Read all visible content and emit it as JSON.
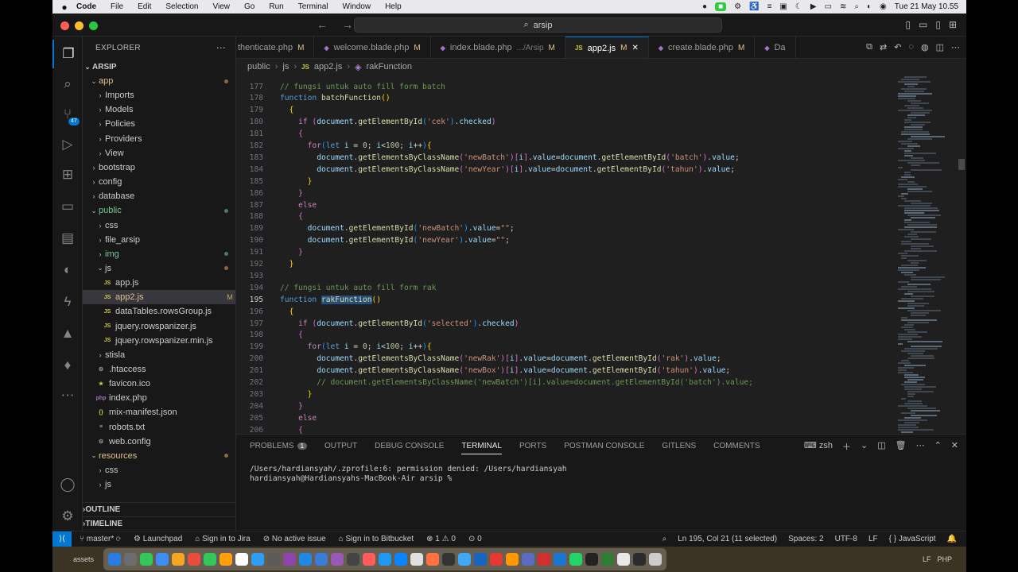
{
  "menubar": {
    "apple": "",
    "items": [
      "Code",
      "File",
      "Edit",
      "Selection",
      "View",
      "Go",
      "Run",
      "Terminal",
      "Window",
      "Help"
    ],
    "clock": "Tue 21 May  10.55"
  },
  "titlebar": {
    "search": "arsip"
  },
  "activity": {
    "source_control_badge": "47"
  },
  "explorer": {
    "title": "EXPLORER",
    "project": "ARSIP",
    "tree": [
      {
        "label": "app",
        "kind": "folder-open",
        "color": "mod",
        "indent": 1,
        "mark": "dot"
      },
      {
        "label": "Imports",
        "kind": "folder",
        "indent": 2
      },
      {
        "label": "Models",
        "kind": "folder",
        "indent": 2
      },
      {
        "label": "Policies",
        "kind": "folder",
        "indent": 2
      },
      {
        "label": "Providers",
        "kind": "folder",
        "indent": 2
      },
      {
        "label": "View",
        "kind": "folder",
        "indent": 2
      },
      {
        "label": "bootstrap",
        "kind": "folder",
        "indent": 1
      },
      {
        "label": "config",
        "kind": "folder",
        "indent": 1
      },
      {
        "label": "database",
        "kind": "folder",
        "indent": 1
      },
      {
        "label": "public",
        "kind": "folder-open",
        "color": "green",
        "indent": 1,
        "mark": "greendot"
      },
      {
        "label": "css",
        "kind": "folder",
        "indent": 2
      },
      {
        "label": "file_arsip",
        "kind": "folder",
        "indent": 2
      },
      {
        "label": "img",
        "kind": "folder",
        "color": "green",
        "indent": 2,
        "mark": "greendot"
      },
      {
        "label": "js",
        "kind": "folder-open",
        "indent": 2,
        "mark": "dot"
      },
      {
        "label": "app.js",
        "kind": "js",
        "indent": 3
      },
      {
        "label": "app2.js",
        "kind": "js",
        "color": "mod",
        "indent": 3,
        "mark": "M",
        "selected": true
      },
      {
        "label": "dataTables.rowsGroup.js",
        "kind": "js",
        "indent": 3
      },
      {
        "label": "jquery.rowspanizer.js",
        "kind": "js",
        "indent": 3
      },
      {
        "label": "jquery.rowspanizer.min.js",
        "kind": "js",
        "indent": 3
      },
      {
        "label": "stisla",
        "kind": "folder",
        "indent": 2
      },
      {
        "label": ".htaccess",
        "kind": "gear",
        "indent": 2
      },
      {
        "label": "favicon.ico",
        "kind": "star",
        "indent": 2
      },
      {
        "label": "index.php",
        "kind": "php",
        "indent": 2
      },
      {
        "label": "mix-manifest.json",
        "kind": "json",
        "indent": 2
      },
      {
        "label": "robots.txt",
        "kind": "txt",
        "indent": 2
      },
      {
        "label": "web.config",
        "kind": "gear",
        "indent": 2
      },
      {
        "label": "resources",
        "kind": "folder-open",
        "color": "mod",
        "indent": 1,
        "mark": "dot"
      },
      {
        "label": "css",
        "kind": "folder",
        "indent": 2
      },
      {
        "label": "js",
        "kind": "folder",
        "indent": 2
      }
    ],
    "outline": "OUTLINE",
    "timeline": "TIMELINE"
  },
  "tabs": [
    {
      "label": "thenticate.php",
      "icon": "php",
      "mark": "M"
    },
    {
      "label": "welcome.blade.php",
      "icon": "php",
      "mark": "M"
    },
    {
      "label": "index.blade.php",
      "icon": "php",
      "path": ".../Arsip",
      "mark": "M"
    },
    {
      "label": "app2.js",
      "icon": "js",
      "mark": "M",
      "active": true
    },
    {
      "label": "create.blade.php",
      "icon": "php",
      "mark": "M"
    },
    {
      "label": "Da",
      "icon": "php",
      "mark": ""
    }
  ],
  "breadcrumb": [
    "public",
    "js",
    "app2.js",
    "rakFunction"
  ],
  "code": [
    {
      "n": "177",
      "t": [
        [
          "cm",
          "// fungsi untuk auto fill form batch"
        ]
      ]
    },
    {
      "n": "178",
      "t": [
        [
          "kw",
          "function "
        ],
        [
          "fn",
          "batchFunction"
        ],
        [
          "br1",
          "()"
        ]
      ]
    },
    {
      "n": "179",
      "t": [
        [
          "plain",
          "  "
        ],
        [
          "br1",
          "{"
        ]
      ]
    },
    {
      "n": "180",
      "t": [
        [
          "plain",
          "    "
        ],
        [
          "ctrl",
          "if "
        ],
        [
          "br2",
          "("
        ],
        [
          "var",
          "document"
        ],
        [
          "plain",
          "."
        ],
        [
          "fn",
          "getElementById"
        ],
        [
          "br3",
          "("
        ],
        [
          "str",
          "'cek'"
        ],
        [
          "br3",
          ")"
        ],
        [
          "plain",
          "."
        ],
        [
          "var",
          "checked"
        ],
        [
          "br2",
          ")"
        ]
      ]
    },
    {
      "n": "181",
      "t": [
        [
          "plain",
          "    "
        ],
        [
          "br2",
          "{"
        ]
      ]
    },
    {
      "n": "182",
      "t": [
        [
          "plain",
          "      "
        ],
        [
          "ctrl",
          "for"
        ],
        [
          "br3",
          "("
        ],
        [
          "kw",
          "let "
        ],
        [
          "var",
          "i"
        ],
        [
          "plain",
          " = "
        ],
        [
          "num-l",
          "0"
        ],
        [
          "plain",
          "; "
        ],
        [
          "var",
          "i"
        ],
        [
          "plain",
          "<"
        ],
        [
          "num-l",
          "100"
        ],
        [
          "plain",
          "; "
        ],
        [
          "var",
          "i"
        ],
        [
          "plain",
          "++"
        ],
        [
          "br3",
          ")"
        ],
        [
          "br1",
          "{"
        ]
      ]
    },
    {
      "n": "183",
      "t": [
        [
          "plain",
          "        "
        ],
        [
          "var",
          "document"
        ],
        [
          "plain",
          "."
        ],
        [
          "fn",
          "getElementsByClassName"
        ],
        [
          "br2",
          "("
        ],
        [
          "str",
          "'newBatch'"
        ],
        [
          "br2",
          ")"
        ],
        [
          "br2",
          "["
        ],
        [
          "var",
          "i"
        ],
        [
          "br2",
          "]"
        ],
        [
          "plain",
          "."
        ],
        [
          "var",
          "value"
        ],
        [
          "plain",
          "="
        ],
        [
          "var",
          "document"
        ],
        [
          "plain",
          "."
        ],
        [
          "fn",
          "getElementById"
        ],
        [
          "br2",
          "("
        ],
        [
          "str",
          "'batch'"
        ],
        [
          "br2",
          ")"
        ],
        [
          "plain",
          "."
        ],
        [
          "var",
          "value"
        ],
        [
          "plain",
          ";"
        ]
      ]
    },
    {
      "n": "184",
      "t": [
        [
          "plain",
          "        "
        ],
        [
          "var",
          "document"
        ],
        [
          "plain",
          "."
        ],
        [
          "fn",
          "getElementsByClassName"
        ],
        [
          "br2",
          "("
        ],
        [
          "str",
          "'newYear'"
        ],
        [
          "br2",
          ")"
        ],
        [
          "br2",
          "["
        ],
        [
          "var",
          "i"
        ],
        [
          "br2",
          "]"
        ],
        [
          "plain",
          "."
        ],
        [
          "var",
          "value"
        ],
        [
          "plain",
          "="
        ],
        [
          "var",
          "document"
        ],
        [
          "plain",
          "."
        ],
        [
          "fn",
          "getElementById"
        ],
        [
          "br2",
          "("
        ],
        [
          "str",
          "'tahun'"
        ],
        [
          "br2",
          ")"
        ],
        [
          "plain",
          "."
        ],
        [
          "var",
          "value"
        ],
        [
          "plain",
          ";"
        ]
      ]
    },
    {
      "n": "185",
      "t": [
        [
          "plain",
          "      "
        ],
        [
          "br1",
          "}"
        ]
      ]
    },
    {
      "n": "186",
      "t": [
        [
          "plain",
          "    "
        ],
        [
          "br2",
          "}"
        ]
      ]
    },
    {
      "n": "187",
      "t": [
        [
          "plain",
          "    "
        ],
        [
          "ctrl",
          "else"
        ]
      ]
    },
    {
      "n": "188",
      "t": [
        [
          "plain",
          "    "
        ],
        [
          "br2",
          "{"
        ]
      ]
    },
    {
      "n": "189",
      "t": [
        [
          "plain",
          "      "
        ],
        [
          "var",
          "document"
        ],
        [
          "plain",
          "."
        ],
        [
          "fn",
          "getElementById"
        ],
        [
          "br3",
          "("
        ],
        [
          "str",
          "'newBatch'"
        ],
        [
          "br3",
          ")"
        ],
        [
          "plain",
          "."
        ],
        [
          "var",
          "value"
        ],
        [
          "plain",
          "="
        ],
        [
          "str",
          "\"\""
        ],
        [
          "plain",
          ";"
        ]
      ]
    },
    {
      "n": "190",
      "t": [
        [
          "plain",
          "      "
        ],
        [
          "var",
          "document"
        ],
        [
          "plain",
          "."
        ],
        [
          "fn",
          "getElementById"
        ],
        [
          "br3",
          "("
        ],
        [
          "str",
          "'newYear'"
        ],
        [
          "br3",
          ")"
        ],
        [
          "plain",
          "."
        ],
        [
          "var",
          "value"
        ],
        [
          "plain",
          "="
        ],
        [
          "str",
          "\"\""
        ],
        [
          "plain",
          ";"
        ]
      ]
    },
    {
      "n": "191",
      "t": [
        [
          "plain",
          "    "
        ],
        [
          "br2",
          "}"
        ]
      ]
    },
    {
      "n": "192",
      "t": [
        [
          "plain",
          "  "
        ],
        [
          "br1",
          "}"
        ]
      ]
    },
    {
      "n": "193",
      "t": [
        [
          "plain",
          ""
        ]
      ]
    },
    {
      "n": "194",
      "t": [
        [
          "cm",
          "// fungsi untuk auto fill form rak"
        ]
      ]
    },
    {
      "n": "195",
      "t": [
        [
          "kw",
          "function "
        ],
        [
          "fn hl",
          "rakFunction"
        ],
        [
          "br1",
          "()"
        ]
      ],
      "cur": true
    },
    {
      "n": "196",
      "t": [
        [
          "plain",
          "  "
        ],
        [
          "br1",
          "{"
        ]
      ]
    },
    {
      "n": "197",
      "t": [
        [
          "plain",
          "    "
        ],
        [
          "ctrl",
          "if "
        ],
        [
          "br2",
          "("
        ],
        [
          "var",
          "document"
        ],
        [
          "plain",
          "."
        ],
        [
          "fn",
          "getElementById"
        ],
        [
          "br3",
          "("
        ],
        [
          "str",
          "'selected'"
        ],
        [
          "br3",
          ")"
        ],
        [
          "plain",
          "."
        ],
        [
          "var",
          "checked"
        ],
        [
          "br2",
          ")"
        ]
      ]
    },
    {
      "n": "198",
      "t": [
        [
          "plain",
          "    "
        ],
        [
          "br2",
          "{"
        ]
      ]
    },
    {
      "n": "199",
      "t": [
        [
          "plain",
          "      "
        ],
        [
          "ctrl",
          "for"
        ],
        [
          "br3",
          "("
        ],
        [
          "kw",
          "let "
        ],
        [
          "var",
          "i"
        ],
        [
          "plain",
          " = "
        ],
        [
          "num-l",
          "0"
        ],
        [
          "plain",
          "; "
        ],
        [
          "var",
          "i"
        ],
        [
          "plain",
          "<"
        ],
        [
          "num-l",
          "100"
        ],
        [
          "plain",
          "; "
        ],
        [
          "var",
          "i"
        ],
        [
          "plain",
          "++"
        ],
        [
          "br3",
          ")"
        ],
        [
          "br1",
          "{"
        ]
      ]
    },
    {
      "n": "200",
      "t": [
        [
          "plain",
          "        "
        ],
        [
          "var",
          "document"
        ],
        [
          "plain",
          "."
        ],
        [
          "fn",
          "getElementsByClassName"
        ],
        [
          "br2",
          "("
        ],
        [
          "str",
          "'newRak'"
        ],
        [
          "br2",
          ")"
        ],
        [
          "br2",
          "["
        ],
        [
          "var",
          "i"
        ],
        [
          "br2",
          "]"
        ],
        [
          "plain",
          "."
        ],
        [
          "var",
          "value"
        ],
        [
          "plain",
          "="
        ],
        [
          "var",
          "document"
        ],
        [
          "plain",
          "."
        ],
        [
          "fn",
          "getElementById"
        ],
        [
          "br2",
          "("
        ],
        [
          "str",
          "'rak'"
        ],
        [
          "br2",
          ")"
        ],
        [
          "plain",
          "."
        ],
        [
          "var",
          "value"
        ],
        [
          "plain",
          ";"
        ]
      ]
    },
    {
      "n": "201",
      "t": [
        [
          "plain",
          "        "
        ],
        [
          "var",
          "document"
        ],
        [
          "plain",
          "."
        ],
        [
          "fn",
          "getElementsByClassName"
        ],
        [
          "br2",
          "("
        ],
        [
          "str",
          "'newBox'"
        ],
        [
          "br2",
          ")"
        ],
        [
          "br2",
          "["
        ],
        [
          "var",
          "i"
        ],
        [
          "br2",
          "]"
        ],
        [
          "plain",
          "."
        ],
        [
          "var",
          "value"
        ],
        [
          "plain",
          "="
        ],
        [
          "var",
          "document"
        ],
        [
          "plain",
          "."
        ],
        [
          "fn",
          "getElementById"
        ],
        [
          "br2",
          "("
        ],
        [
          "str",
          "'tahun'"
        ],
        [
          "br2",
          ")"
        ],
        [
          "plain",
          "."
        ],
        [
          "var",
          "value"
        ],
        [
          "plain",
          ";"
        ]
      ]
    },
    {
      "n": "202",
      "t": [
        [
          "plain",
          "        "
        ],
        [
          "cm",
          "// document.getElementsByClassName('newBatch')[i].value=document.getElementById('batch').value;"
        ]
      ]
    },
    {
      "n": "203",
      "t": [
        [
          "plain",
          "      "
        ],
        [
          "br1",
          "}"
        ]
      ]
    },
    {
      "n": "204",
      "t": [
        [
          "plain",
          "    "
        ],
        [
          "br2",
          "}"
        ]
      ]
    },
    {
      "n": "205",
      "t": [
        [
          "plain",
          "    "
        ],
        [
          "ctrl",
          "else"
        ]
      ]
    },
    {
      "n": "206",
      "t": [
        [
          "plain",
          "    "
        ],
        [
          "br2",
          "{"
        ]
      ]
    }
  ],
  "panel": {
    "tabs": [
      "PROBLEMS",
      "OUTPUT",
      "DEBUG CONSOLE",
      "TERMINAL",
      "PORTS",
      "POSTMAN CONSOLE",
      "GITLENS",
      "COMMENTS"
    ],
    "active_tab": "TERMINAL",
    "problems_count": "1",
    "shell": "zsh",
    "terminal_lines": [
      "/Users/hardiansyah/.zprofile:6: permission denied: /Users/hardiansyah",
      "hardiansyah@Hardiansyahs-MacBook-Air arsip % "
    ]
  },
  "status": {
    "branch": "master*",
    "launchpad": "Launchpad",
    "jira": "Sign in to Jira",
    "issue": "No active issue",
    "bitbucket": "Sign in to Bitbucket",
    "errors": "1",
    "warnings": "0",
    "ports": "0",
    "cursor": "Ln 195, Col 21 (11 selected)",
    "spaces": "Spaces: 2",
    "encoding": "UTF-8",
    "eol": "LF",
    "language": "JavaScript"
  },
  "dockbar": {
    "left": "assets",
    "right_labels": [
      "LF",
      "PHP"
    ]
  },
  "colors": {
    "accent": "#0078d4",
    "modified": "#e2c08d",
    "untracked": "#73c991"
  }
}
